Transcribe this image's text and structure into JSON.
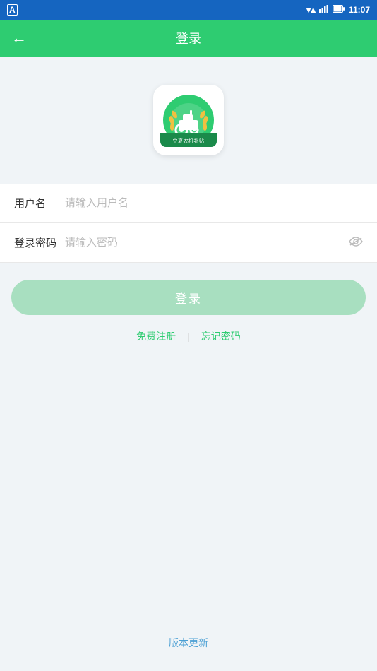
{
  "statusBar": {
    "time": "11:07",
    "aLabel": "A"
  },
  "navBar": {
    "title": "登录",
    "backIcon": "←"
  },
  "logo": {
    "altText": "宁夏农机补贴 App Logo"
  },
  "form": {
    "usernameLabel": "用户名",
    "usernamePlaceholder": "请输入用户名",
    "passwordLabel": "登录密码",
    "passwordPlaceholder": "请输入密码"
  },
  "loginButton": {
    "label": "登录"
  },
  "links": {
    "register": "免费注册",
    "forgotPassword": "忘记密码",
    "divider": "|"
  },
  "footer": {
    "versionUpdate": "版本更新"
  }
}
